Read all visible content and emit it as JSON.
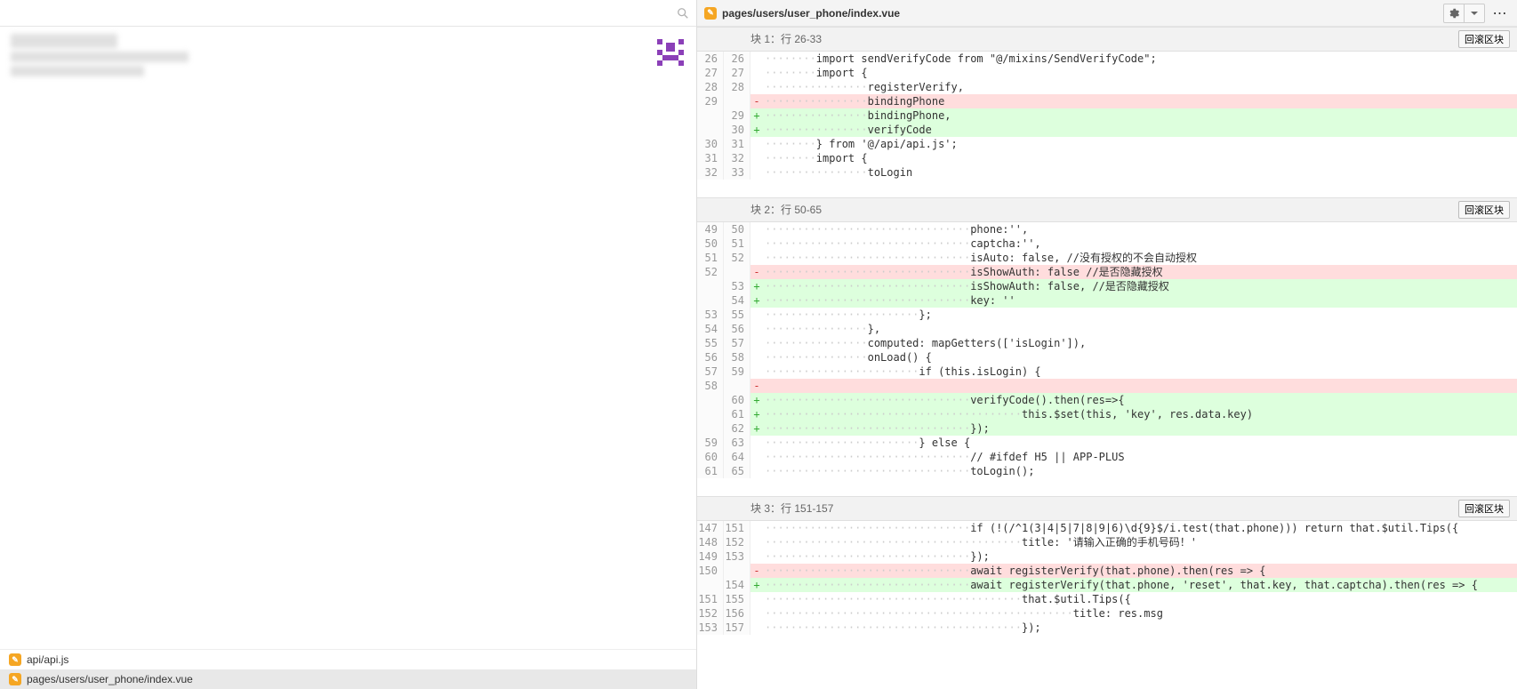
{
  "header": {
    "file_path": "pages/users/user_phone/index.vue",
    "revert_label": "回滚区块"
  },
  "files": [
    {
      "path": "api/api.js",
      "selected": false
    },
    {
      "path": "pages/users/user_phone/index.vue",
      "selected": true
    }
  ],
  "hunks": [
    {
      "title": "块 1：行 26-33",
      "rows": [
        {
          "o": "26",
          "n": "26",
          "m": " ",
          "t": "ctx",
          "c": "        import sendVerifyCode from \"@/mixins/SendVerifyCode\";"
        },
        {
          "o": "27",
          "n": "27",
          "m": " ",
          "t": "ctx",
          "c": "        import {"
        },
        {
          "o": "28",
          "n": "28",
          "m": " ",
          "t": "ctx",
          "c": "                registerVerify,"
        },
        {
          "o": "29",
          "n": "",
          "m": "-",
          "t": "del",
          "c": "                bindingPhone"
        },
        {
          "o": "",
          "n": "29",
          "m": "+",
          "t": "add",
          "c": "                bindingPhone,"
        },
        {
          "o": "",
          "n": "30",
          "m": "+",
          "t": "add",
          "c": "                verifyCode"
        },
        {
          "o": "30",
          "n": "31",
          "m": " ",
          "t": "ctx",
          "c": "        } from '@/api/api.js';"
        },
        {
          "o": "31",
          "n": "32",
          "m": " ",
          "t": "ctx",
          "c": "        import {"
        },
        {
          "o": "32",
          "n": "33",
          "m": " ",
          "t": "ctx",
          "c": "                toLogin"
        }
      ]
    },
    {
      "title": "块 2：行 50-65",
      "rows": [
        {
          "o": "49",
          "n": "50",
          "m": " ",
          "t": "ctx",
          "c": "                                phone:'',"
        },
        {
          "o": "50",
          "n": "51",
          "m": " ",
          "t": "ctx",
          "c": "                                captcha:'',"
        },
        {
          "o": "51",
          "n": "52",
          "m": " ",
          "t": "ctx",
          "c": "                                isAuto: false, //没有授权的不会自动授权"
        },
        {
          "o": "52",
          "n": "",
          "m": "-",
          "t": "del",
          "c": "                                isShowAuth: false //是否隐藏授权"
        },
        {
          "o": "",
          "n": "53",
          "m": "+",
          "t": "add",
          "c": "                                isShowAuth: false, //是否隐藏授权"
        },
        {
          "o": "",
          "n": "54",
          "m": "+",
          "t": "add",
          "c": "                                key: ''"
        },
        {
          "o": "53",
          "n": "55",
          "m": " ",
          "t": "ctx",
          "c": "                        };"
        },
        {
          "o": "54",
          "n": "56",
          "m": " ",
          "t": "ctx",
          "c": "                },"
        },
        {
          "o": "55",
          "n": "57",
          "m": " ",
          "t": "ctx",
          "c": "                computed: mapGetters(['isLogin']),"
        },
        {
          "o": "56",
          "n": "58",
          "m": " ",
          "t": "ctx",
          "c": "                onLoad() {"
        },
        {
          "o": "57",
          "n": "59",
          "m": " ",
          "t": "ctx",
          "c": "                        if (this.isLogin) {"
        },
        {
          "o": "58",
          "n": "",
          "m": "-",
          "t": "del",
          "c": ""
        },
        {
          "o": "",
          "n": "60",
          "m": "+",
          "t": "add",
          "c": "                                verifyCode().then(res=>{"
        },
        {
          "o": "",
          "n": "61",
          "m": "+",
          "t": "add",
          "c": "                                        this.$set(this, 'key', res.data.key)"
        },
        {
          "o": "",
          "n": "62",
          "m": "+",
          "t": "add",
          "c": "                                });"
        },
        {
          "o": "59",
          "n": "63",
          "m": " ",
          "t": "ctx",
          "c": "                        } else {"
        },
        {
          "o": "60",
          "n": "64",
          "m": " ",
          "t": "ctx",
          "c": "                                // #ifdef H5 || APP-PLUS"
        },
        {
          "o": "61",
          "n": "65",
          "m": " ",
          "t": "ctx",
          "c": "                                toLogin();"
        }
      ]
    },
    {
      "title": "块 3：行 151-157",
      "rows": [
        {
          "o": "147",
          "n": "151",
          "m": " ",
          "t": "ctx",
          "c": "                                if (!(/^1(3|4|5|7|8|9|6)\\d{9}$/i.test(that.phone))) return that.$util.Tips({"
        },
        {
          "o": "148",
          "n": "152",
          "m": " ",
          "t": "ctx",
          "c": "                                        title: '请输入正确的手机号码！'"
        },
        {
          "o": "149",
          "n": "153",
          "m": " ",
          "t": "ctx",
          "c": "                                });"
        },
        {
          "o": "150",
          "n": "",
          "m": "-",
          "t": "del",
          "c": "                                await registerVerify(that.phone).then(res => {"
        },
        {
          "o": "",
          "n": "154",
          "m": "+",
          "t": "add",
          "c": "                                await registerVerify(that.phone, 'reset', that.key, that.captcha).then(res => {"
        },
        {
          "o": "151",
          "n": "155",
          "m": " ",
          "t": "ctx",
          "c": "                                        that.$util.Tips({"
        },
        {
          "o": "152",
          "n": "156",
          "m": " ",
          "t": "ctx",
          "c": "                                                title: res.msg"
        },
        {
          "o": "153",
          "n": "157",
          "m": " ",
          "t": "ctx",
          "c": "                                        });"
        }
      ]
    }
  ]
}
